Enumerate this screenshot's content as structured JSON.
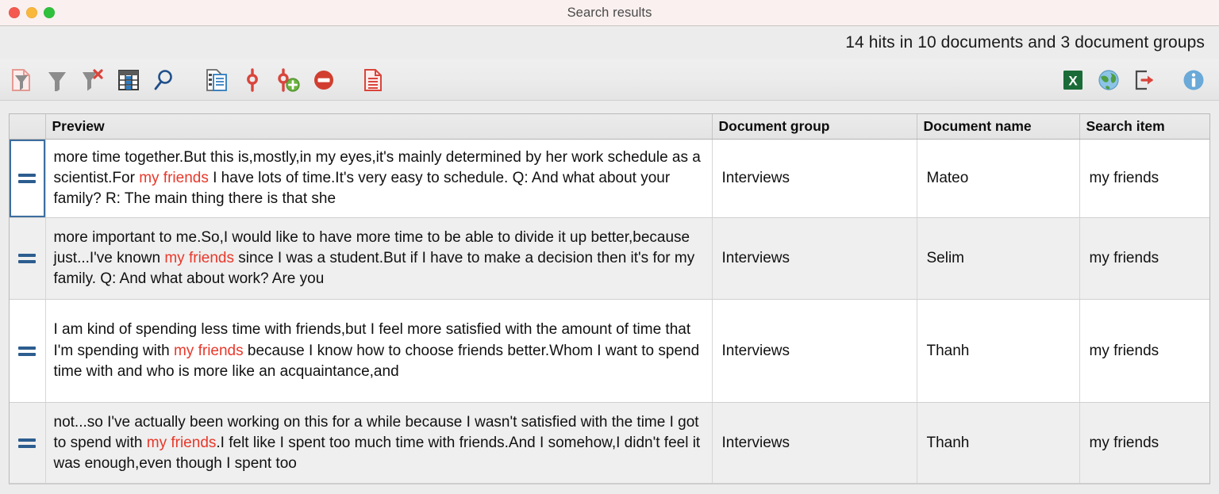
{
  "window": {
    "title": "Search results",
    "traffic_lights": [
      "close",
      "minimize",
      "maximize"
    ]
  },
  "status": {
    "hits_text": "14 hits in 10 documents and 3 document groups",
    "hits_count": 14,
    "documents_count": 10,
    "document_groups_count": 3
  },
  "toolbar": {
    "left_items": [
      {
        "name": "filter-document-icon",
        "tooltip": "Filter document"
      },
      {
        "name": "filter-icon",
        "tooltip": "Set filter"
      },
      {
        "name": "filter-clear-icon",
        "tooltip": "Reset filter"
      },
      {
        "name": "table-grid-icon",
        "tooltip": "Column settings"
      },
      {
        "name": "search-magnifier-icon",
        "tooltip": "Search"
      },
      {
        "name": "document-list-icon",
        "tooltip": "Open document"
      },
      {
        "name": "code-node-icon",
        "tooltip": "Code"
      },
      {
        "name": "code-add-icon",
        "tooltip": "Code with new code"
      },
      {
        "name": "delete-minus-icon",
        "tooltip": "Delete"
      },
      {
        "name": "document-red-icon",
        "tooltip": "Create memo"
      }
    ],
    "right_items": [
      {
        "name": "export-excel-icon",
        "tooltip": "Export to Excel",
        "label": "X"
      },
      {
        "name": "export-web-icon",
        "tooltip": "Export to HTML"
      },
      {
        "name": "export-arrow-icon",
        "tooltip": "Export"
      },
      {
        "name": "info-icon",
        "tooltip": "Information"
      }
    ]
  },
  "table": {
    "columns": [
      {
        "key": "mark",
        "label": ""
      },
      {
        "key": "preview",
        "label": "Preview"
      },
      {
        "key": "group",
        "label": "Document group"
      },
      {
        "key": "docname",
        "label": "Document name"
      },
      {
        "key": "item",
        "label": "Search item"
      }
    ],
    "rows": [
      {
        "marker": "equals-icon",
        "selected": true,
        "preview_parts": [
          {
            "text": " more time together.But this is,mostly,in my eyes,it's mainly determined by her work schedule as a scientist.For ",
            "hit": false
          },
          {
            "text": "my friends",
            "hit": true
          },
          {
            "text": " I have lots of time.It's very easy to schedule.  Q: And what about your family?   R: The main thing there is that she",
            "hit": false
          }
        ],
        "group": "Interviews",
        "docname": "Mateo",
        "item": "my friends"
      },
      {
        "marker": "equals-icon",
        "selected": false,
        "preview_parts": [
          {
            "text": " more important to me.So,I would like to have more time to be able to divide it up better,because just...I've known ",
            "hit": false
          },
          {
            "text": "my friends",
            "hit": true
          },
          {
            "text": " since I was a student.But if I have to make a decision then it's for my family.  Q: And what about work? Are you",
            "hit": false
          }
        ],
        "group": "Interviews",
        "docname": "Selim",
        "item": "my friends"
      },
      {
        "marker": "equals-icon",
        "selected": false,
        "preview_parts": [
          {
            "text": " I am kind of spending less time with friends,but I feel more satisfied with the amount of time that I'm spending with ",
            "hit": false
          },
          {
            "text": "my friends",
            "hit": true
          },
          {
            "text": " because I know how to choose friends better.Whom I want to spend time with and who is more like an acquaintance,and",
            "hit": false
          }
        ],
        "group": "Interviews",
        "docname": "Thanh",
        "item": "my friends"
      },
      {
        "marker": "equals-icon",
        "selected": false,
        "preview_parts": [
          {
            "text": " not...so I've actually been working on this for a while because I wasn't satisfied with the time I got to spend with ",
            "hit": false
          },
          {
            "text": "my friends",
            "hit": true
          },
          {
            "text": ".I felt like I spent too much time with friends.And I somehow,I didn't feel it was enough,even though I spent too",
            "hit": false
          }
        ],
        "group": "Interviews",
        "docname": "Thanh",
        "item": "my friends"
      }
    ]
  },
  "colors": {
    "titlebar_bg": "#faf0ef",
    "hit_highlight": "#e8382a",
    "selection_border": "#3d6e9e",
    "marker_blue": "#2c5d8f",
    "row_alt_bg": "#efefef",
    "toolbar_bg": "#ebebeb"
  }
}
